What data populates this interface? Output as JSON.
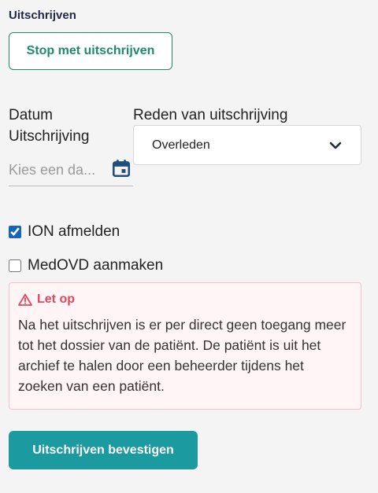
{
  "section": {
    "title": "Uitschrijven"
  },
  "stop_button": {
    "label": "Stop met uitschrijven"
  },
  "date": {
    "label": "Datum Uitschrijving",
    "placeholder": "Kies een da...",
    "icon": "calendar-icon"
  },
  "reason": {
    "label": "Reden van uitschrijving",
    "selected": "Overleden",
    "icon": "chevron-down-icon"
  },
  "checkboxes": [
    {
      "label": "ION afmelden",
      "checked": true
    },
    {
      "label": "MedOVD aanmaken",
      "checked": false
    }
  ],
  "alert": {
    "title": "Let op",
    "icon": "warning-icon",
    "text": "Na het uitschrijven is er per direct geen toegang meer tot het dossier van de patiënt. De patiënt is uit het archief te halen door een beheerder tijdens het zoeken van een patiënt."
  },
  "confirm_button": {
    "label": "Uitschrijven bevestigen"
  },
  "colors": {
    "accent_green": "#1f8a6b",
    "accent_teal": "#1b9aa0",
    "warning": "#e0485f",
    "checkbox": "#1565c0"
  }
}
